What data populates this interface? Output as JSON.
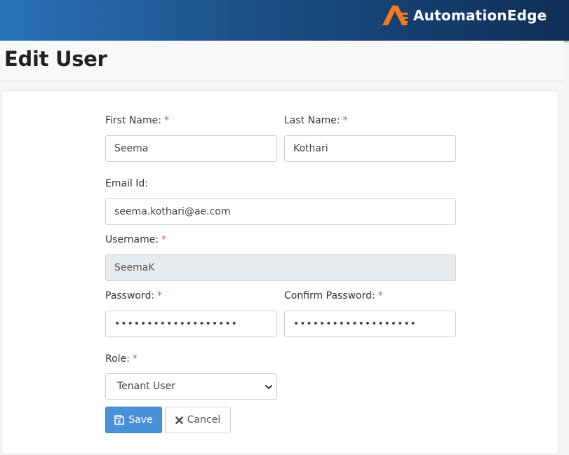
{
  "header": {
    "brand": "AutomationEdge",
    "brand_color": "#f47a20",
    "logo_icon": "automationedge-logo-icon"
  },
  "page": {
    "title": "Edit User"
  },
  "form": {
    "first_name": {
      "label": "First Name:",
      "required": "*",
      "value": "Seema"
    },
    "last_name": {
      "label": "Last Name:",
      "required": "*",
      "value": "Kothari"
    },
    "email": {
      "label": "Email Id:",
      "value": "seema.kothari@ae.com"
    },
    "username": {
      "label": "Username:",
      "required": "*",
      "value": "SeemaK"
    },
    "password": {
      "label": "Password:",
      "required": "*",
      "value": "•••••••••••••••••••"
    },
    "confirm_password": {
      "label": "Confirm Password:",
      "required": "*",
      "value": "•••••••••••••••••••"
    },
    "role": {
      "label": "Role:",
      "required": "*",
      "selected": "Tenant User",
      "icon": "chevron-down-icon"
    }
  },
  "actions": {
    "save_label": "Save",
    "save_icon": "floppy-disk-icon",
    "cancel_label": "Cancel",
    "cancel_icon": "close-icon"
  }
}
